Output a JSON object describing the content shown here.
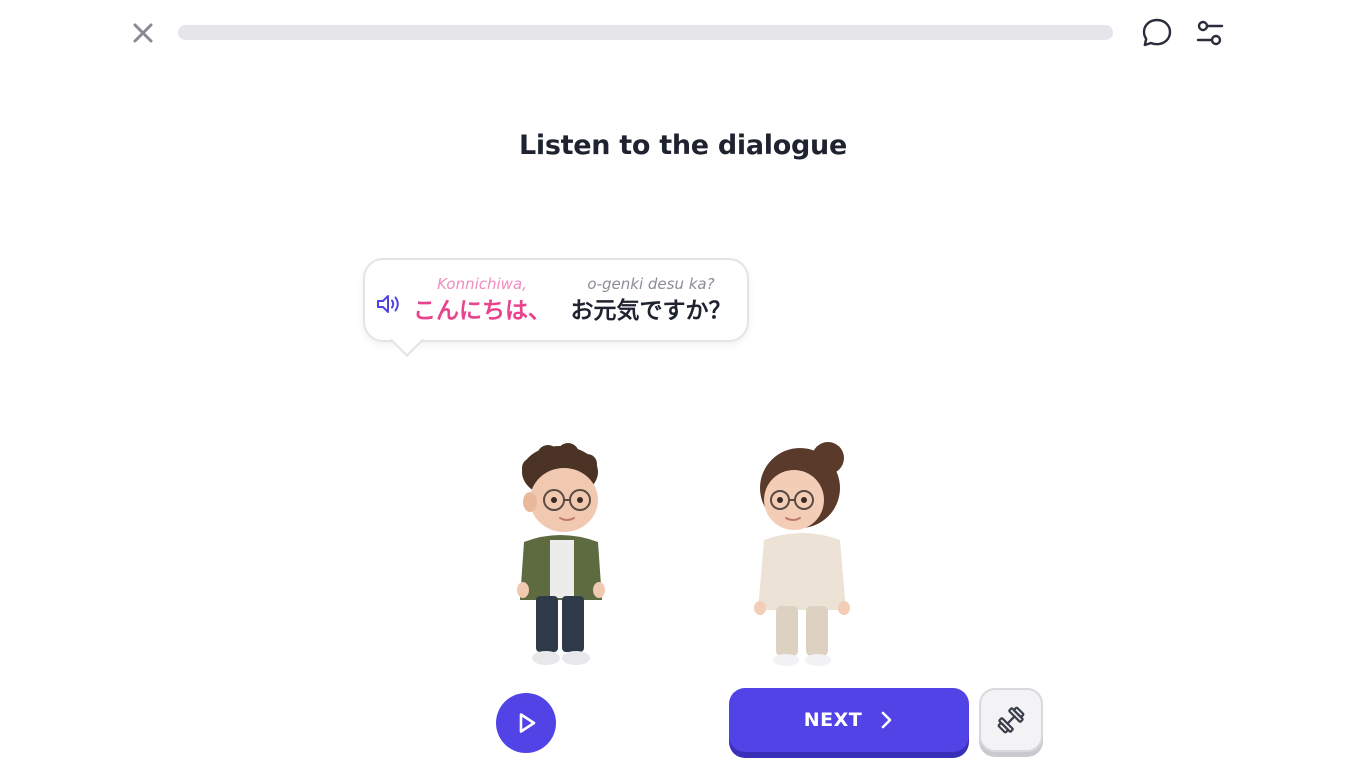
{
  "header": {
    "close_icon": "close-icon",
    "progress_fraction": 0.0,
    "chat_icon": "chat-bubble-icon",
    "settings_icon": "sliders-icon"
  },
  "main": {
    "title": "Listen to the dialogue",
    "bubble": {
      "speaker_icon": "speaker-icon",
      "phrases": [
        {
          "romaji": "Konnichiwa,",
          "kana": "こんにちは、"
        },
        {
          "romaji": "o-genki desu ka?",
          "kana": "お元気ですか？"
        }
      ]
    },
    "characters": [
      "man-with-glasses",
      "woman-with-glasses"
    ]
  },
  "footer": {
    "play_icon": "play-icon",
    "next_label": "NEXT",
    "next_icon": "chevron-right-icon",
    "practice_icon": "dumbbell-icon"
  },
  "colors": {
    "accent": "#5243e6",
    "highlight_pink": "#e9438e",
    "romaji_pink": "#f08cc1",
    "text_dark": "#1f2330",
    "muted": "#8c8c96"
  }
}
